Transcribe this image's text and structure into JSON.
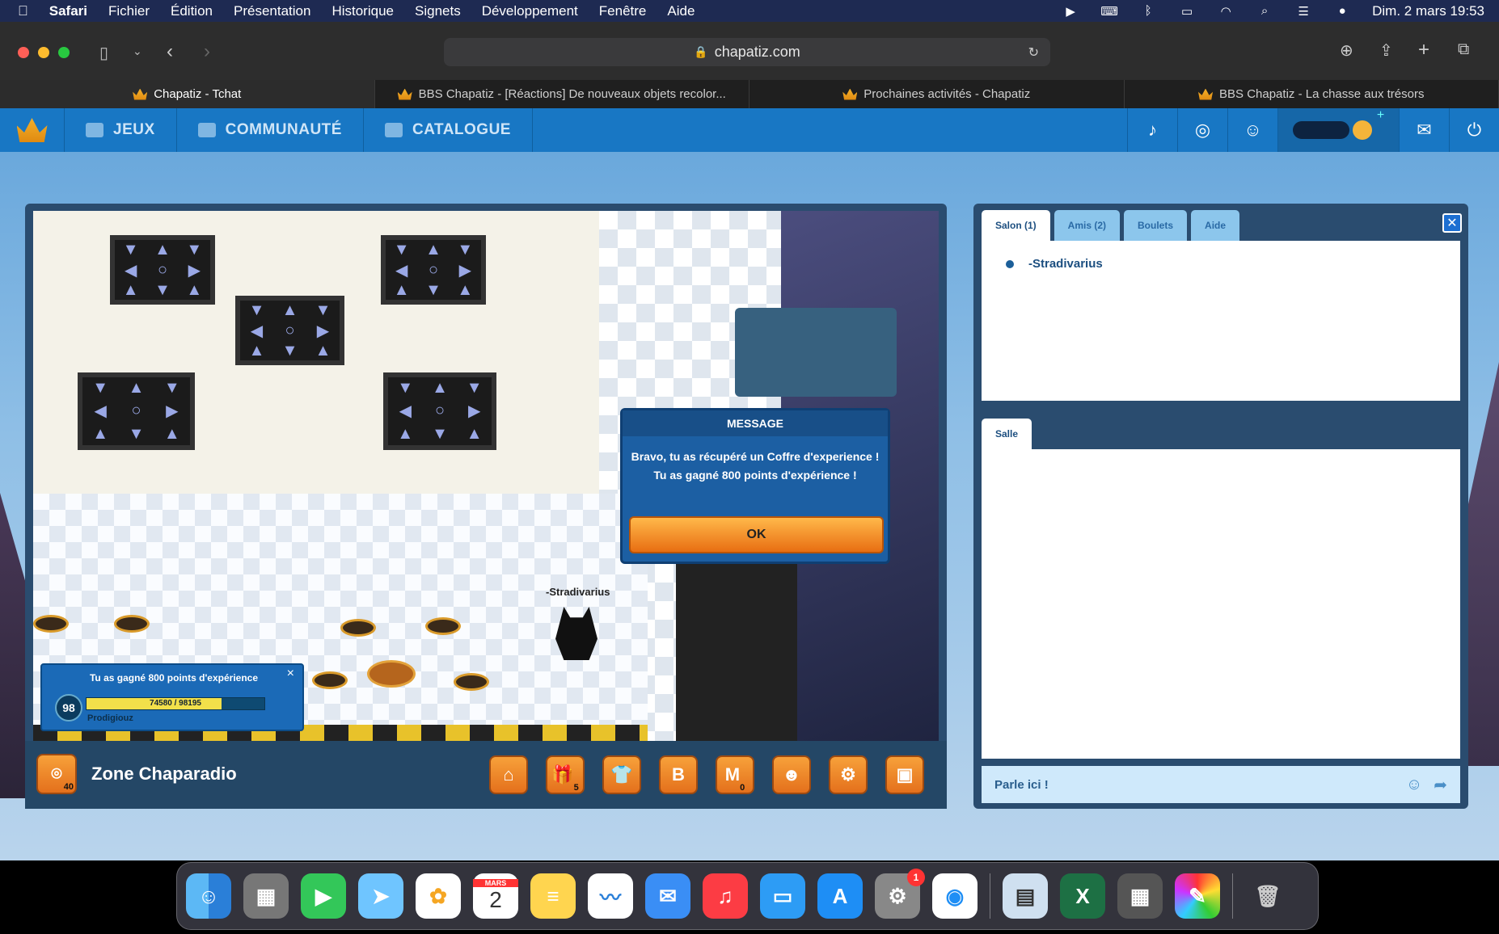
{
  "menubar": {
    "apple": "",
    "app": "Safari",
    "items": [
      "Fichier",
      "Édition",
      "Présentation",
      "Historique",
      "Signets",
      "Développement",
      "Fenêtre",
      "Aide"
    ],
    "clock": "Dim. 2 mars  19:53"
  },
  "browser": {
    "url": "chapatiz.com",
    "tabs": [
      {
        "label": "Chapatiz - Tchat",
        "active": true
      },
      {
        "label": "BBS Chapatiz - [Réactions] De nouveaux objets recolor...",
        "active": false
      },
      {
        "label": "Prochaines activités - Chapatiz",
        "active": false
      },
      {
        "label": "BBS Chapatiz - La chasse aux trésors",
        "active": false
      }
    ]
  },
  "site_nav": {
    "items": [
      "JEUX",
      "COMMUNAUTÉ",
      "CATALOGUE"
    ]
  },
  "game": {
    "player_name": "-Stradivarius",
    "zone_name": "Zone Chaparadio",
    "zone_badge": "40",
    "message": {
      "title": "MESSAGE",
      "line1": "Bravo, tu as récupéré un Coffre d'experience !",
      "line2": "Tu as gagné 800 points d'expérience !",
      "ok": "OK"
    },
    "xp_popup": {
      "title": "Tu as gagné 800 points d'expérience",
      "level": "98",
      "progress_text": "74580 / 98195",
      "progress_fraction": 0.76,
      "rank": "Prodigiouz",
      "close": "×"
    },
    "toolbar_icons": [
      "home-icon",
      "gift-icon",
      "shirt-icon",
      "b-coin-icon",
      "m-icon",
      "avatar-icon",
      "settings-icon",
      "radio-icon"
    ],
    "gift_count": "5",
    "m_count": "0"
  },
  "chat": {
    "tabs": [
      "Salon (1)",
      "Amis (2)",
      "Boulets",
      "Aide"
    ],
    "users": [
      "-Stradivarius"
    ],
    "room_tab": "Salle",
    "input_placeholder": "Parle ici !"
  },
  "dock": {
    "calendar_month": "MARS",
    "calendar_day": "2",
    "settings_badge": "1"
  }
}
